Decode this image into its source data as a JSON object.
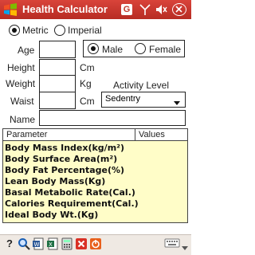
{
  "titlebar": {
    "title": "Health Calculator",
    "start_icon": "windows-flag-icon",
    "signal_icon": "signal-icon",
    "volume_icon": "volume-icon",
    "close_label": "ok"
  },
  "units": {
    "metric_label": "Metric",
    "imperial_label": "Imperial",
    "selected": "Metric"
  },
  "gender": {
    "male_label": "Male",
    "female_label": "Female",
    "selected": "Male"
  },
  "form": {
    "age_label": "Age",
    "height_label": "Height",
    "height_unit": "Cm",
    "weight_label": "Weight",
    "weight_unit": "Kg",
    "waist_label": "Waist",
    "waist_unit": "Cm",
    "name_label": "Name",
    "activity_label": "Activity Level",
    "activity_value": "Sedentry"
  },
  "table": {
    "col_parameter": "Parameter",
    "col_values": "Values",
    "rows": [
      "Body Mass Index(kg/m²)",
      "Body Surface Area(m²)",
      "Body Fat Percentage(%)",
      "Lean Body Mass(Kg)",
      "Basal Metabolic Rate(Cal.)",
      "Calories Requirement(Cal.)",
      "Ideal Body Wt.(Kg)"
    ]
  },
  "colors": {
    "titlebar": "#c0392b",
    "table_bg": "#fffdc8"
  }
}
